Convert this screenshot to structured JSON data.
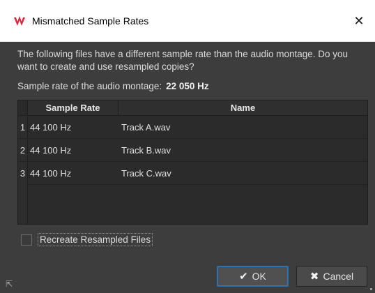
{
  "window": {
    "title": "Mismatched Sample Rates",
    "close_glyph": "✕",
    "logo_icon": "wavelab-logo-icon"
  },
  "dialog": {
    "description": "The following files have a different sample rate than the audio montage. Do you want to create and use resampled copies?",
    "rate_label": "Sample rate of the audio montage:",
    "rate_value": "22 050 Hz"
  },
  "table": {
    "columns": [
      "Sample Rate",
      "Name"
    ],
    "rows": [
      {
        "index": "1",
        "sample_rate": "44 100 Hz",
        "name": "Track A.wav"
      },
      {
        "index": "2",
        "sample_rate": "44 100 Hz",
        "name": "Track B.wav"
      },
      {
        "index": "3",
        "sample_rate": "44 100 Hz",
        "name": "Track C.wav"
      }
    ]
  },
  "options": {
    "recreate_label": "Recreate Resampled Files",
    "recreate_checked": false
  },
  "buttons": {
    "ok_label": "OK",
    "ok_icon": "checkmark-icon",
    "cancel_label": "Cancel",
    "cancel_icon": "x-icon"
  },
  "colors": {
    "body_bg": "#3d3d3d",
    "titlebar_bg": "#ffffff",
    "table_bg": "#2b2b2b",
    "logo": "#e0243d",
    "ok_focus": "#2f76b7"
  }
}
